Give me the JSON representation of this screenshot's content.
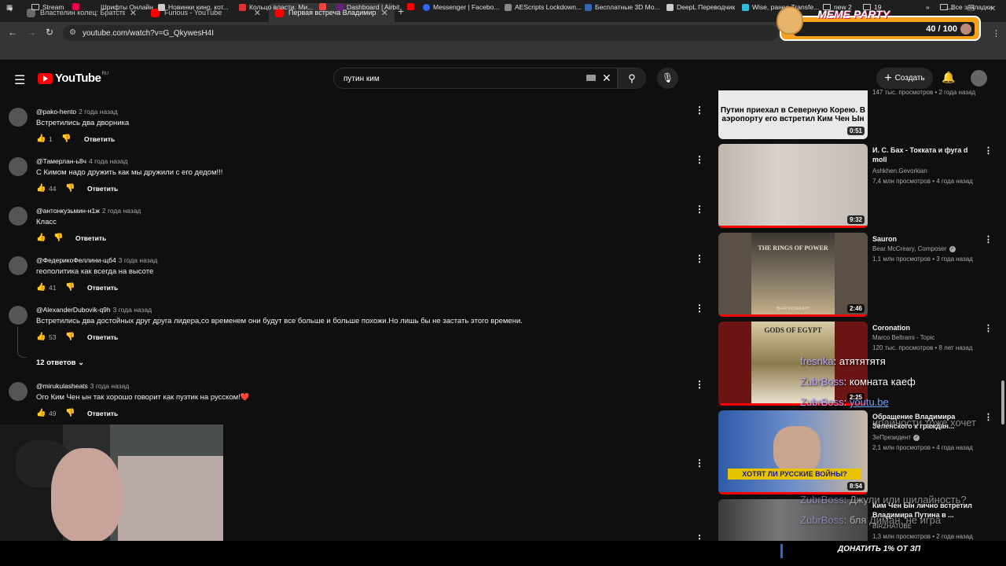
{
  "browser": {
    "tabs": [
      {
        "title": "Властелин колец: Братство кол",
        "color": "#6a6a6a"
      },
      {
        "title": "Furious - YouTube",
        "color": "#f00"
      },
      {
        "title": "Первая встреча Владимира П",
        "color": "#f00"
      }
    ],
    "new_tab": "+",
    "url": "youtube.com/watch?v=G_QkywesH4I",
    "bookmarks": [
      {
        "label": "Stream",
        "type": "folder"
      },
      {
        "label": "Шрифты Онлайн",
        "type": "site",
        "color": "#e04"
      },
      {
        "label": "Новинки кино, кот...",
        "type": "site",
        "color": "#ccc"
      },
      {
        "label": "Кольцо власти. Ми...",
        "type": "site",
        "color": "#d33"
      },
      {
        "label": "",
        "type": "site",
        "color": "#e44"
      },
      {
        "label": "Dashboard | Airbit",
        "type": "site",
        "color": "#627"
      },
      {
        "label": "",
        "type": "site",
        "color": "#f00"
      },
      {
        "label": "Messenger | Facebo...",
        "type": "site",
        "color": "#36f"
      },
      {
        "label": "AEScripts Lockdown...",
        "type": "site",
        "color": "#888"
      },
      {
        "label": "Бесплатные 3D Мо...",
        "type": "site",
        "color": "#36a"
      },
      {
        "label": "DeepL Переводчик",
        "type": "site",
        "color": "#ccc"
      },
      {
        "label": "Wise, ранее Transfe...",
        "type": "site",
        "color": "#3bd"
      },
      {
        "label": "new 2",
        "type": "folder"
      },
      {
        "label": "19",
        "type": "folder"
      }
    ],
    "bookmarks_more": "»",
    "all_bookmarks": "Все закладки"
  },
  "meme": {
    "title": "MEME PARTY",
    "count": "40 / 100"
  },
  "youtube": {
    "logo": "YouTube",
    "region": "RU",
    "search_query": "путин ким",
    "create_label": "Создать"
  },
  "comments": [
    {
      "author": "@pako-hento",
      "ago": "2 года назад",
      "text": "Встретились два дворника",
      "likes": "1",
      "reply": "Ответить"
    },
    {
      "author": "@Тамерлан-ь8ч",
      "ago": "4 года назад",
      "text": "С Кимом надо дружить как мы дружили с его дедом!!!",
      "likes": "44",
      "reply": "Ответить"
    },
    {
      "author": "@антонкузьмин-н1ж",
      "ago": "2 года назад",
      "text": "Класс",
      "likes": "",
      "reply": "Ответить"
    },
    {
      "author": "@ФедерикоФеллини-щб4",
      "ago": "3 года назад",
      "text": "геополитика как всегда на высоте",
      "likes": "41",
      "reply": "Ответить"
    },
    {
      "author": "@AlexanderDubovik-q9h",
      "ago": "3 года назад",
      "text": "Встретились два достойных друг друга лидера,со временем они будут все больше и больше похожи.Но лишь бы не застать этого времени.",
      "likes": "53",
      "reply": "Ответить"
    },
    {
      "author": "@mirukulasheats",
      "ago": "3 года назад",
      "text": "Ого Ким Чен ын так хорошо говорит как пузтик на русском!❤️",
      "likes": "49",
      "reply": "Ответить"
    }
  ],
  "replies_label": "12 ответов",
  "sidebar": {
    "videos": [
      {
        "title": "",
        "channel": "",
        "meta": "147 тыс. просмотров • 2 года назад",
        "duration": "0:51",
        "thumb_text": "Путин приехал в Северную Корею. В аэропорту его встретил Ким Чен Ын",
        "thumb_color": "#e9e9e9"
      },
      {
        "title": "И. С. Бах - Токката и фуга d moll",
        "channel": "Ashkhen.Gevorkian",
        "meta": "7,4 млн просмотров • 4 года назад",
        "duration": "9:32",
        "thumb_color": "#cfc7c0"
      },
      {
        "title": "Sauron",
        "channel": "Bear McCreary, Composer",
        "meta": "1,1 млн просмотров • 3 года назад",
        "duration": "2:46",
        "thumb_color": "#5a5046",
        "thumb_text": "THE RINGS OF POWER",
        "thumb_sub": "BEAR McCREARY"
      },
      {
        "title": "Coronation",
        "channel": "Marco Beltrami - Topic",
        "meta": "120 тыс. просмотров • 8 лет назад",
        "duration": "2:25",
        "thumb_color": "#6b1414",
        "thumb_text": "GODS OF EGYPT"
      },
      {
        "title": "Обращение Владимира Зеленского к граждан...",
        "channel": "ЗеПрезидент",
        "meta": "2,1 млн просмотров • 4 года назад",
        "duration": "8:54",
        "thumb_color": "#2d5aa8",
        "thumb_text": "ХОТЯТ ЛИ РУССКИЕ ВОЙНЫ?"
      },
      {
        "title": "Ким Чен Ын лично встретил Владимира Путина в ...",
        "channel": "BIRZHATUBE",
        "meta": "1,3 млн просмотров • 2 года назад",
        "duration": "",
        "thumb_color": "#4a4a4a"
      }
    ]
  },
  "chat": [
    {
      "name": "fresnka",
      "text": "атятятятя"
    },
    {
      "name": "ZubrBoss",
      "text": "комната каеф"
    },
    {
      "name": "ZubrBoss",
      "text": "youtu.be"
    },
    {
      "name": "",
      "text": "ирайности тоже хочет"
    },
    {
      "name": "ZubrBoss",
      "text": "Джули или шилайность?"
    },
    {
      "name": "ZubrBoss",
      "text": "бля Диман, не игра"
    }
  ],
  "donate": "ДОНАТИТЬ 1% ОТ ЗП",
  "colors": {
    "bg": "#0f0f0f",
    "accent": "#ff0000",
    "meme": "#f6a21a"
  }
}
